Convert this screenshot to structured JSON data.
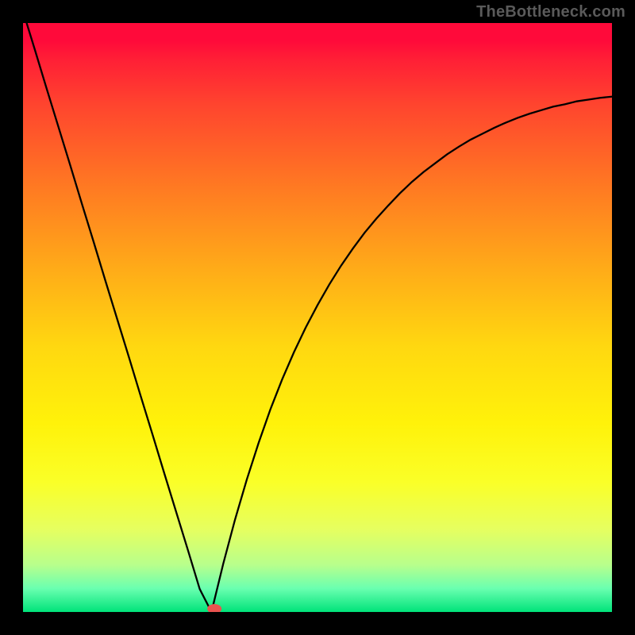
{
  "watermark": "TheBottleneck.com",
  "colors": {
    "outer_border": "#000000",
    "curve": "#000000",
    "marker": "#e9534f",
    "gradient_stops": [
      "#ff0a3a",
      "#ff1e36",
      "#ff452e",
      "#ff7a22",
      "#ffac18",
      "#ffd810",
      "#fff20a",
      "#faff28",
      "#e6ff60",
      "#b8ff8c",
      "#6affb0",
      "#00e37a"
    ]
  },
  "chart_data": {
    "type": "line",
    "title": "",
    "xlabel": "",
    "ylabel": "",
    "x": [
      0.0,
      0.02,
      0.04,
      0.06,
      0.08,
      0.1,
      0.12,
      0.14,
      0.16,
      0.18,
      0.2,
      0.22,
      0.24,
      0.26,
      0.28,
      0.3,
      0.32,
      0.34,
      0.36,
      0.38,
      0.4,
      0.42,
      0.44,
      0.46,
      0.48,
      0.5,
      0.52,
      0.54,
      0.56,
      0.58,
      0.6,
      0.62,
      0.64,
      0.66,
      0.68,
      0.7,
      0.72,
      0.74,
      0.76,
      0.78,
      0.8,
      0.82,
      0.84,
      0.86,
      0.88,
      0.9,
      0.92,
      0.94,
      0.96,
      0.98,
      1.0,
      1.02
    ],
    "values": [
      1.02,
      0.955,
      0.889,
      0.824,
      0.759,
      0.693,
      0.628,
      0.562,
      0.497,
      0.432,
      0.366,
      0.301,
      0.235,
      0.17,
      0.105,
      0.039,
      0.0,
      0.082,
      0.157,
      0.225,
      0.287,
      0.344,
      0.395,
      0.441,
      0.483,
      0.521,
      0.556,
      0.588,
      0.617,
      0.644,
      0.668,
      0.69,
      0.711,
      0.73,
      0.747,
      0.762,
      0.777,
      0.79,
      0.802,
      0.812,
      0.822,
      0.831,
      0.839,
      0.846,
      0.852,
      0.858,
      0.862,
      0.867,
      0.87,
      0.873,
      0.875,
      0.877
    ],
    "xlim": [
      0,
      1
    ],
    "ylim": [
      0,
      1
    ],
    "minimum_point": {
      "x": 0.325,
      "y": 0.0
    },
    "annotations": []
  }
}
